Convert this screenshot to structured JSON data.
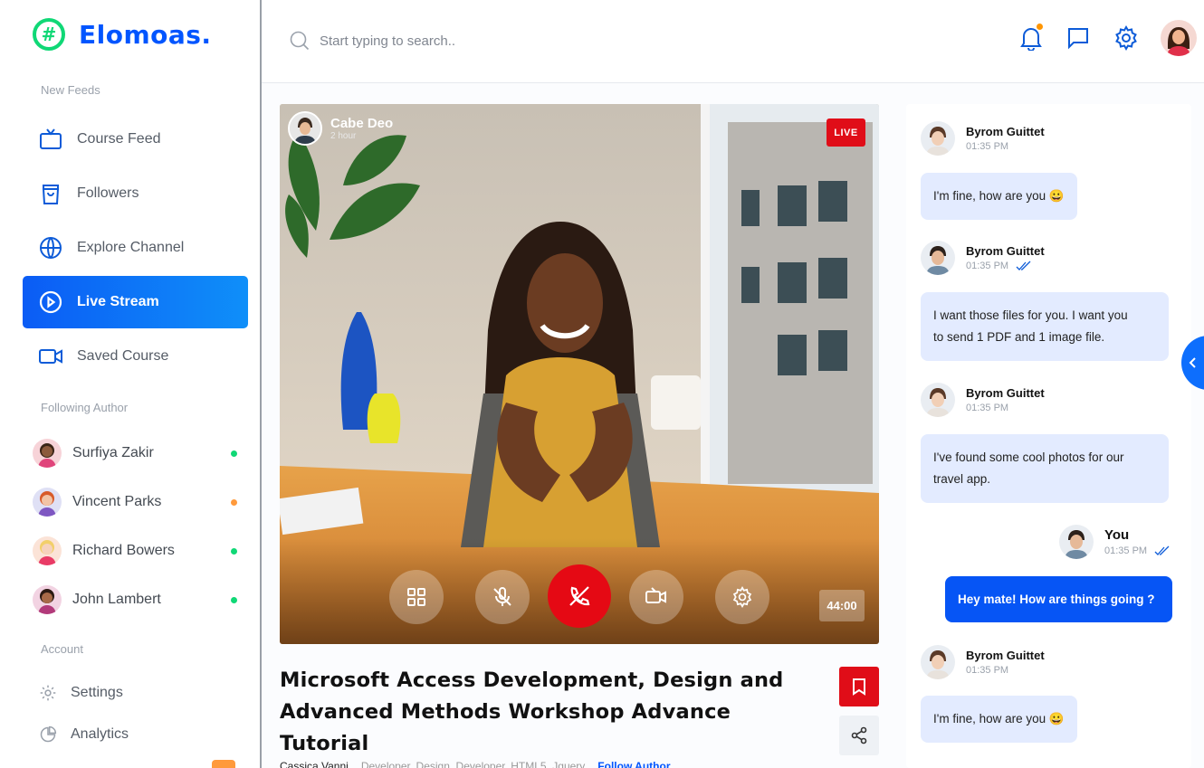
{
  "brand": {
    "name": "Elomoas.",
    "mark": "#"
  },
  "sidebar": {
    "feeds_label": "New Feeds",
    "items": [
      {
        "label": "Course Feed",
        "icon": "tv-icon"
      },
      {
        "label": "Followers",
        "icon": "bag-icon"
      },
      {
        "label": "Explore Channel",
        "icon": "globe-icon"
      },
      {
        "label": "Live Stream",
        "icon": "play-circle-icon",
        "active": true
      },
      {
        "label": "Saved Course",
        "icon": "video-icon"
      }
    ],
    "following_label": "Following Author",
    "authors": [
      {
        "name": "Surfiya Zakir",
        "status_color": "#10d876"
      },
      {
        "name": "Vincent Parks",
        "status_color": "#ff9a3c"
      },
      {
        "name": "Richard Bowers",
        "status_color": "#10d876"
      },
      {
        "name": "John Lambert",
        "status_color": "#10d876"
      }
    ],
    "account_label": "Account",
    "account_items": [
      {
        "label": "Settings",
        "icon": "gear-icon"
      },
      {
        "label": "Analytics",
        "icon": "pie-chart-icon"
      }
    ]
  },
  "header": {
    "search_placeholder": "Start typing to search..",
    "icons": [
      "bell-icon",
      "message-icon",
      "gear-icon"
    ]
  },
  "video": {
    "streamer_name": "Cabe Deo",
    "streamer_time": "2 hour",
    "live_label": "LIVE",
    "timer": "44:00",
    "controls": [
      "grid-icon",
      "mic-off-icon",
      "phone-off-icon",
      "video-off-icon",
      "gear-icon"
    ]
  },
  "course": {
    "title_line1": "Microsoft Access Development, Design and",
    "title_line2": "Advanced Methods Workshop Advance Tutorial",
    "author": "Cassica Vanni",
    "tags": "Developer, Design, Developer, HTML5, Jquery",
    "follow_label": "Follow Author"
  },
  "chat": {
    "messages": [
      {
        "name": "Byrom Guittet",
        "time": "01:35 PM",
        "text": "I'm fine, how are you 😀",
        "read": false
      },
      {
        "name": "Byrom Guittet",
        "time": "01:35 PM",
        "text_line1": "I want those files for you. I want you",
        "text_line2": "to send 1 PDF and 1 image file.",
        "read": true
      },
      {
        "name": "Byrom Guittet",
        "time": "01:35 PM",
        "text_line1": "I've found some cool photos for our",
        "text_line2": "travel app.",
        "read": false
      },
      {
        "name": "You",
        "time": "01:35 PM",
        "text": "Hey mate! How are things going ?",
        "read": true
      },
      {
        "name": "Byrom Guittet",
        "time": "01:35 PM",
        "text": "I'm fine, how are you 😀",
        "read": false
      }
    ]
  },
  "colors": {
    "primary": "#0055ff",
    "accent_green": "#10d876",
    "live_red": "#e00d18",
    "bubble": "#e3ebff"
  }
}
